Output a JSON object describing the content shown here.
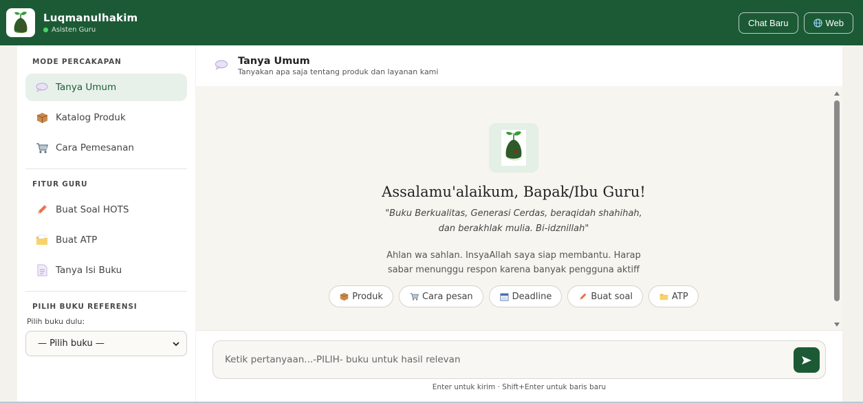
{
  "header": {
    "app_name": "Luqmanulhakim",
    "status": "Asisten Guru",
    "new_chat_label": "Chat Baru",
    "web_label": "Web"
  },
  "sidebar": {
    "mode_title": "MODE PERCAKAPAN",
    "modes": [
      {
        "label": "Tanya Umum",
        "icon": "speech-bubble-icon"
      },
      {
        "label": "Katalog Produk",
        "icon": "package-icon"
      },
      {
        "label": "Cara Pemesanan",
        "icon": "cart-icon"
      }
    ],
    "features_title": "FITUR GURU",
    "features": [
      {
        "label": "Buat Soal HOTS",
        "icon": "pencil-icon"
      },
      {
        "label": "Buat ATP",
        "icon": "folder-icon"
      },
      {
        "label": "Tanya Isi Buku",
        "icon": "document-icon"
      }
    ],
    "book_title": "PILIH BUKU REFERENSI",
    "book_label": "Pilih buku dulu:",
    "book_selected": "— Pilih buku —"
  },
  "main": {
    "title": "Tanya Umum",
    "subtitle": "Tanyakan apa saja tentang produk dan layanan kami"
  },
  "welcome": {
    "greeting": "Assalamu'alaikum, Bapak/Ibu Guru!",
    "quote_line1": "\"Buku Berkualitas, Generasi Cerdas, beraqidah shahihah,",
    "quote_line2": "dan berakhlak mulia. Bi-idznillah\"",
    "text_line1": "Ahlan wa sahlan. InsyaAllah saya siap membantu. Harap",
    "text_line2": "sabar menunggu respon karena banyak pengguna aktiff",
    "chips": [
      {
        "label": "Produk",
        "icon": "package-icon"
      },
      {
        "label": "Cara pesan",
        "icon": "cart-icon"
      },
      {
        "label": "Deadline",
        "icon": "calendar-icon"
      },
      {
        "label": "Buat soal",
        "icon": "pencil-icon"
      },
      {
        "label": "ATP",
        "icon": "folder-icon"
      }
    ]
  },
  "composer": {
    "placeholder": "Ketik pertanyaan...-PILIH- buku untuk hasil relevan",
    "hint": "Enter untuk kirim · Shift+Enter untuk baris baru"
  },
  "colors": {
    "brand": "#1c5a36",
    "active_bg": "#e7f1ea",
    "online": "#4cd36a"
  }
}
